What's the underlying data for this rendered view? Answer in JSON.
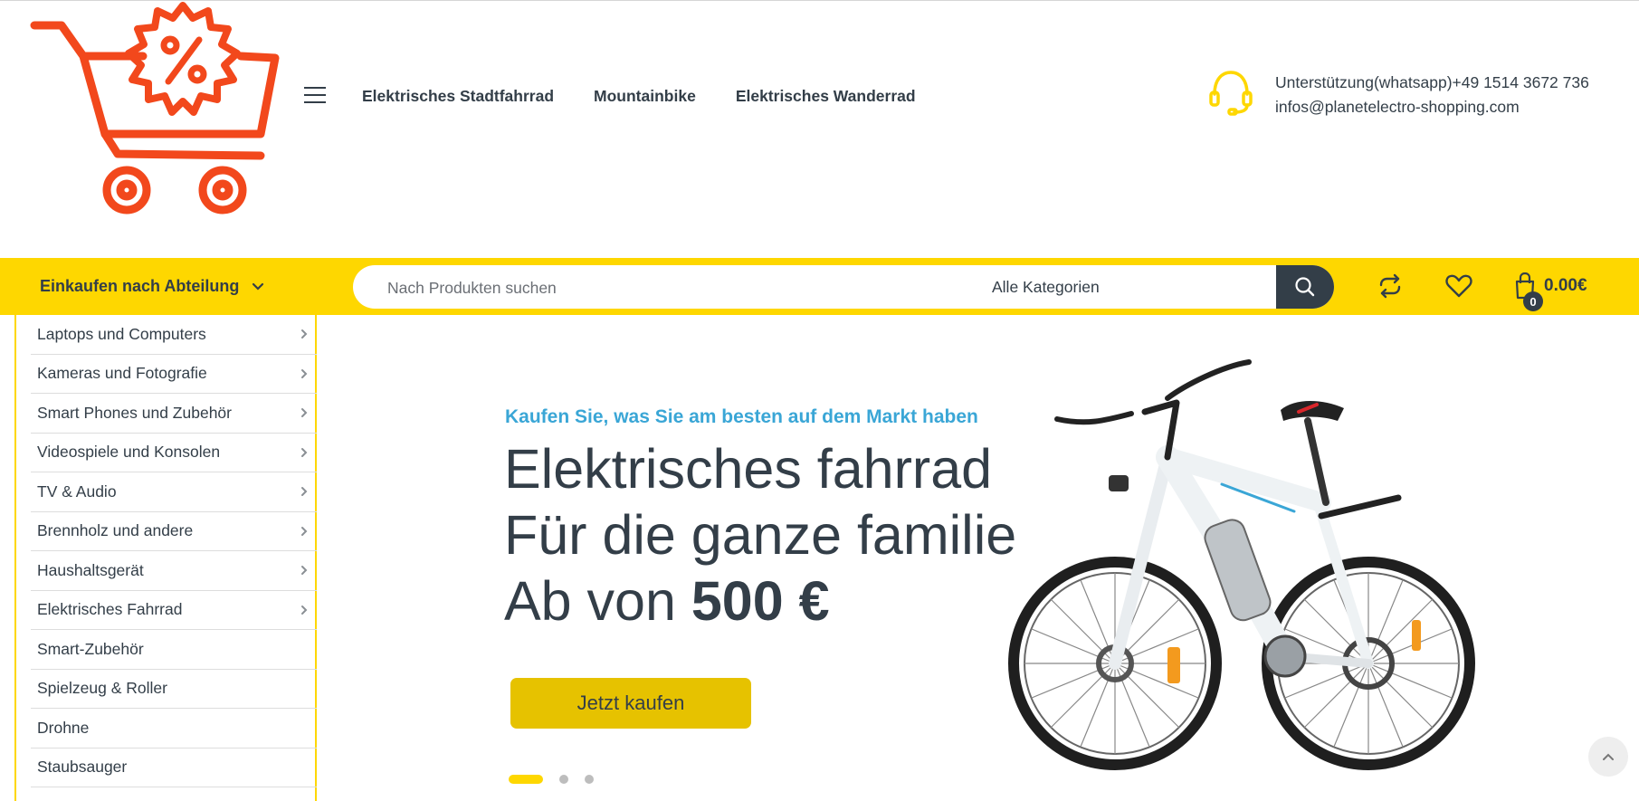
{
  "header": {
    "nav": [
      {
        "label": "Elektrisches Stadtfahrrad"
      },
      {
        "label": "Mountainbike"
      },
      {
        "label": "Elektrisches Wanderrad"
      }
    ],
    "support_line1": "Unterstützung(whatsapp)+49 1514 3672 736",
    "support_line2": "infos@planetelectro-shopping.com"
  },
  "toolbar": {
    "department_label": "Einkaufen nach Abteilung",
    "search_placeholder": "Nach Produkten suchen",
    "category_selected": "Alle Kategorien",
    "cart_count": "0",
    "cart_total": "0.00€"
  },
  "sidebar": {
    "items": [
      {
        "label": "Laptops und Computers",
        "has_submenu": true
      },
      {
        "label": "Kameras und Fotografie",
        "has_submenu": true
      },
      {
        "label": "Smart Phones und Zubehör",
        "has_submenu": true
      },
      {
        "label": "Videospiele und Konsolen",
        "has_submenu": true
      },
      {
        "label": "TV & Audio",
        "has_submenu": true
      },
      {
        "label": "Brennholz und andere",
        "has_submenu": true
      },
      {
        "label": "Haushaltsgerät",
        "has_submenu": true
      },
      {
        "label": "Elektrisches Fahrrad",
        "has_submenu": true
      },
      {
        "label": "Smart-Zubehör",
        "has_submenu": false
      },
      {
        "label": "Spielzeug & Roller",
        "has_submenu": false
      },
      {
        "label": "Drohne",
        "has_submenu": false
      },
      {
        "label": "Staubsauger",
        "has_submenu": false
      }
    ]
  },
  "hero": {
    "subtitle": "Kaufen Sie, was Sie am besten auf dem Markt haben",
    "title_line1": "Elektrisches fahrrad",
    "title_line2": "Für die ganze familie",
    "title_line3_prefix": "Ab von",
    "title_line3_price": "500 €",
    "button_label": "Jetzt kaufen",
    "slides": 3,
    "active_slide": 1
  },
  "colors": {
    "accent_yellow": "#fed700",
    "dark": "#333e48",
    "subtitle_blue": "#3aa6d6",
    "logo_red": "#f2481c"
  },
  "icons": [
    "shopping-cart-percent-logo",
    "hamburger-icon",
    "headset-icon",
    "chevron-down-icon",
    "search-icon",
    "compare-icon",
    "heart-icon",
    "shopping-bag-icon",
    "chevron-right-icon",
    "arrow-up-icon"
  ]
}
